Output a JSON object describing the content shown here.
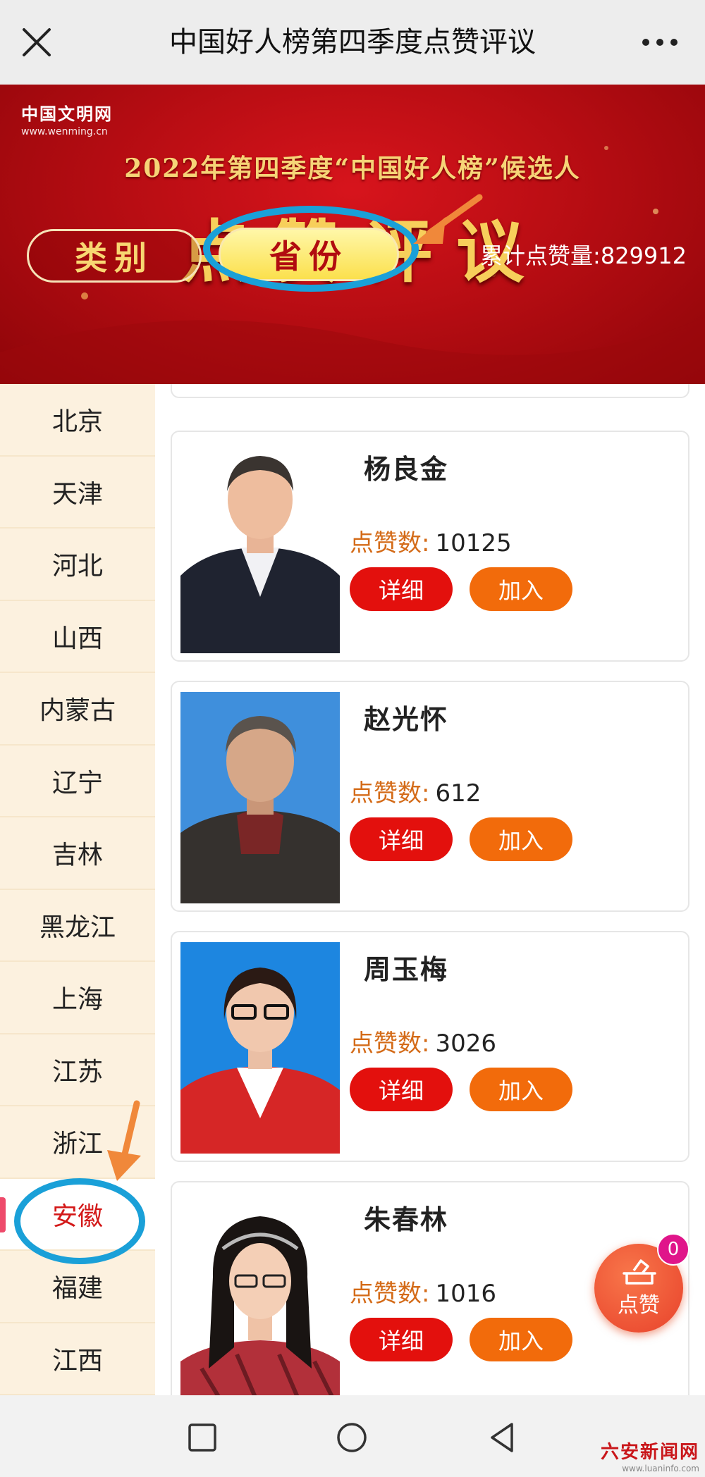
{
  "topbar": {
    "title": "中国好人榜第四季度点赞评议",
    "close_icon": "close-icon",
    "more_icon": "more-icon"
  },
  "banner": {
    "logo_text": "中国文明网",
    "logo_url": "www.wenming.cn",
    "subtitle": "2022年第四季度“中国好人榜”候选人",
    "title": "点赞评议",
    "tab_category": "类别",
    "tab_province": "省份",
    "total_likes": "累计点赞量:829912"
  },
  "sidebar": {
    "items": [
      {
        "label": "北京"
      },
      {
        "label": "天津"
      },
      {
        "label": "河北"
      },
      {
        "label": "山西"
      },
      {
        "label": "内蒙古"
      },
      {
        "label": "辽宁"
      },
      {
        "label": "吉林"
      },
      {
        "label": "黑龙江"
      },
      {
        "label": "上海"
      },
      {
        "label": "江苏"
      },
      {
        "label": "浙江"
      },
      {
        "label": "安徽",
        "active": true
      },
      {
        "label": "福建"
      },
      {
        "label": "江西"
      }
    ]
  },
  "candidates": [
    {
      "name": "杨良金",
      "likes_label": "点赞数:",
      "likes": "10125",
      "detail_label": "详细",
      "join_label": "加入"
    },
    {
      "name": "赵光怀",
      "likes_label": "点赞数:",
      "likes": "612",
      "detail_label": "详细",
      "join_label": "加入"
    },
    {
      "name": "周玉梅",
      "likes_label": "点赞数:",
      "likes": "3026",
      "detail_label": "详细",
      "join_label": "加入"
    },
    {
      "name": "朱春林",
      "likes_label": "点赞数:",
      "likes": "1016",
      "detail_label": "详细",
      "join_label": "加入"
    }
  ],
  "vote": {
    "label": "点赞",
    "count": "0"
  },
  "watermark": {
    "name": "六安新闻网",
    "url": "www.luaninfo.com"
  },
  "colors": {
    "accent_red": "#e3100d",
    "accent_orange": "#f26b0b",
    "highlight_circle": "#1aa0d8",
    "arrow": "#f0883a"
  }
}
